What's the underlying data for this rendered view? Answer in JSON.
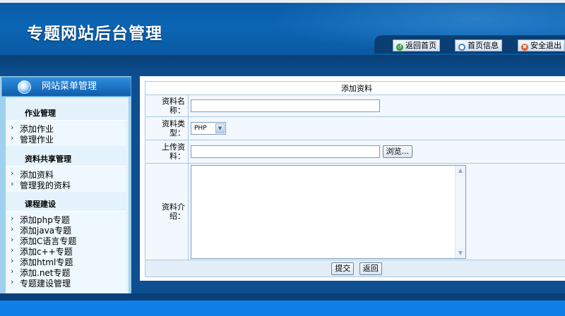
{
  "header": {
    "title": "专题网站后台管理",
    "nav": [
      {
        "label": "返回首页",
        "icon": "back-icon"
      },
      {
        "label": "首页信息",
        "icon": "info-icon"
      },
      {
        "label": "安全退出",
        "icon": "close-icon"
      }
    ]
  },
  "sidebar": {
    "title": "网站菜单管理",
    "sections": [
      {
        "title": "作业管理",
        "items": [
          "添加作业",
          "管理作业"
        ]
      },
      {
        "title": "资料共享管理",
        "items": [
          "添加资料",
          "管理我的资料"
        ]
      },
      {
        "title": "课程建设",
        "items": [
          "添加php专题",
          "添加java专题",
          "添加C语言专题",
          "添加c++专题",
          "添加html专题",
          "添加.net专题",
          "专题建设管理"
        ]
      }
    ]
  },
  "form": {
    "title": "添加资料",
    "name_label_1": "资料名",
    "name_label_2": "称：",
    "name_value": "",
    "type_label_1": "资料类",
    "type_label_2": "型：",
    "type_selected": "PHP",
    "upload_label_1": "上传资",
    "upload_label_2": "料：",
    "browse_label": "浏览...",
    "intro_label_1": "资料介",
    "intro_label_2": "绍：",
    "submit_label": "提交",
    "back_label": "返回"
  },
  "colors": {
    "header_blue": "#0b65b4",
    "sidebar_bg": "#9fd0ee",
    "form_border": "#aac9e2"
  }
}
